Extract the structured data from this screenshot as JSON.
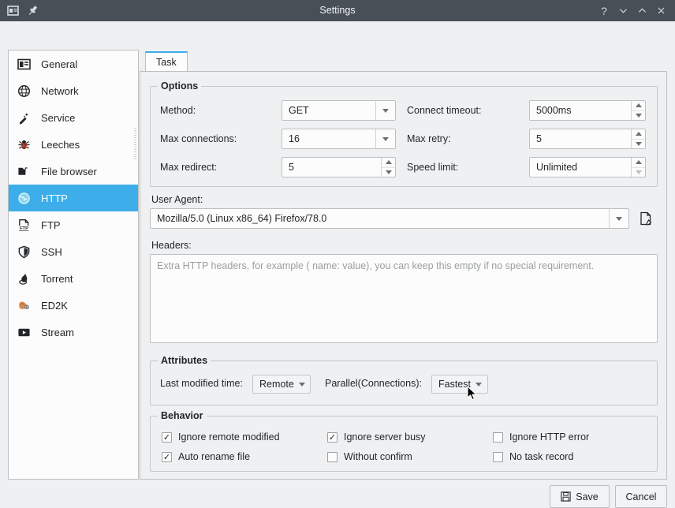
{
  "window": {
    "title": "Settings",
    "app_icon": "window-icon",
    "pin_icon": "pin-icon",
    "controls": [
      {
        "name": "help-button",
        "glyph": "?"
      },
      {
        "name": "minimize-button",
        "glyph": "chevron-down-icon"
      },
      {
        "name": "maximize-button",
        "glyph": "chevron-up-icon"
      },
      {
        "name": "close-button",
        "glyph": "close-icon"
      }
    ]
  },
  "colors": {
    "accent": "#3daee9",
    "titlebar": "#475057",
    "window_bg": "#eff0f1",
    "field_bg": "#fcfcfc",
    "border": "#bcbfc2"
  },
  "sidebar": {
    "items": [
      {
        "label": "General",
        "icon": "general-icon",
        "selected": false
      },
      {
        "label": "Network",
        "icon": "network-icon",
        "selected": false
      },
      {
        "label": "Service",
        "icon": "service-icon",
        "selected": false
      },
      {
        "label": "Leeches",
        "icon": "leeches-icon",
        "selected": false
      },
      {
        "label": "File browser",
        "icon": "folder-icon",
        "selected": false
      },
      {
        "label": "HTTP",
        "icon": "globe-icon",
        "selected": true
      },
      {
        "label": "FTP",
        "icon": "ftp-icon",
        "selected": false
      },
      {
        "label": "SSH",
        "icon": "shield-icon",
        "selected": false
      },
      {
        "label": "Torrent",
        "icon": "torrent-icon",
        "selected": false
      },
      {
        "label": "ED2K",
        "icon": "ed2k-icon",
        "selected": false
      },
      {
        "label": "Stream",
        "icon": "play-icon",
        "selected": false
      }
    ]
  },
  "tabs": [
    {
      "label": "Task",
      "selected": true
    }
  ],
  "options": {
    "group_title": "Options",
    "method": {
      "label": "Method:",
      "value": "GET",
      "control": "combobox"
    },
    "max_connections": {
      "label": "Max connections:",
      "value": "16",
      "control": "combobox"
    },
    "max_redirect": {
      "label": "Max redirect:",
      "value": "5",
      "control": "spinbox"
    },
    "connect_timeout": {
      "label": "Connect timeout:",
      "value": "5000ms",
      "control": "spinbox"
    },
    "max_retry": {
      "label": "Max retry:",
      "value": "5",
      "control": "spinbox"
    },
    "speed_limit": {
      "label": "Speed limit:",
      "value": "Unlimited",
      "control": "spinbox"
    }
  },
  "user_agent": {
    "label": "User Agent:",
    "value": "Mozilla/5.0 (Linux x86_64) Firefox/78.0",
    "edit_icon": "edit-document-icon"
  },
  "headers": {
    "label": "Headers:",
    "value": "",
    "placeholder": "Extra HTTP headers, for example ( name: value), you can keep this empty if no special requirement."
  },
  "attributes": {
    "group_title": "Attributes",
    "last_modified_time": {
      "label": "Last modified time:",
      "value": "Remote"
    },
    "parallel_connections": {
      "label": "Parallel(Connections):",
      "value": "Fastest"
    }
  },
  "behavior": {
    "group_title": "Behavior",
    "checkboxes": [
      {
        "label": "Ignore remote modified",
        "checked": true
      },
      {
        "label": "Ignore server busy",
        "checked": true
      },
      {
        "label": "Ignore HTTP error",
        "checked": false
      },
      {
        "label": "Auto rename file",
        "checked": true
      },
      {
        "label": "Without confirm",
        "checked": false
      },
      {
        "label": "No task record",
        "checked": false
      }
    ]
  },
  "footer": {
    "save_label": "Save",
    "save_icon": "floppy-disk-icon",
    "cancel_label": "Cancel"
  }
}
